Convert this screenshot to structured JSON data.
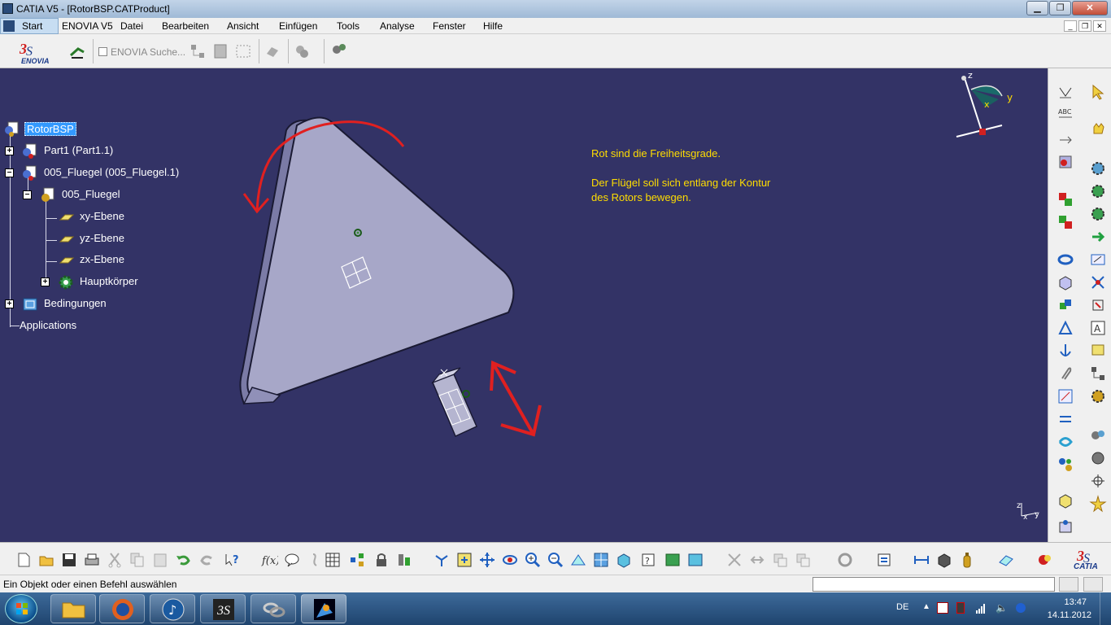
{
  "window": {
    "title": "CATIA V5 - [RotorBSP.CATProduct]",
    "minimize": "▁",
    "maximize": "❐",
    "close": "✕"
  },
  "menu": {
    "items": [
      {
        "label": "Start"
      },
      {
        "label": "ENOVIA V5"
      },
      {
        "label": "Datei"
      },
      {
        "label": "Bearbeiten"
      },
      {
        "label": "Ansicht"
      },
      {
        "label": "Einfügen"
      },
      {
        "label": "Tools"
      },
      {
        "label": "Analyse"
      },
      {
        "label": "Fenster"
      },
      {
        "label": "Hilfe"
      }
    ],
    "mdi_min": "_",
    "mdi_restore": "❐",
    "mdi_close": "✕"
  },
  "toolbar": {
    "enovia_logo_text": "ENOVIA",
    "search_label": "ENOVIA Suche..."
  },
  "tree": {
    "nodes": [
      {
        "label": "RotorBSP"
      },
      {
        "label": "Part1 (Part1.1)"
      },
      {
        "label": "005_Fluegel (005_Fluegel.1)"
      },
      {
        "label": "005_Fluegel"
      },
      {
        "label": "xy-Ebene"
      },
      {
        "label": "yz-Ebene"
      },
      {
        "label": "zx-Ebene"
      },
      {
        "label": "Hauptkörper"
      },
      {
        "label": "Bedingungen"
      },
      {
        "label": "Applications"
      }
    ]
  },
  "annotation": {
    "line1": "Rot sind die Freiheitsgrade.",
    "line2": "Der Flügel soll sich entlang der Kontur",
    "line3": "des Rotors bewegen."
  },
  "compass": {
    "z": "z",
    "x": "x",
    "y": "y"
  },
  "axis_mini": {
    "z": "z",
    "x": "x",
    "y": "y"
  },
  "statusbar": {
    "message": "Ein Objekt oder einen Befehl auswählen"
  },
  "catia_logo": "CATIA",
  "taskbar": {
    "lang": "DE",
    "time": "13:47",
    "date": "14.11.2012"
  },
  "colors": {
    "viewport_bg": "#333366",
    "annotation": "#ffdd00",
    "dof_arrows": "#e02020",
    "tree_selected": "#3399ff"
  }
}
